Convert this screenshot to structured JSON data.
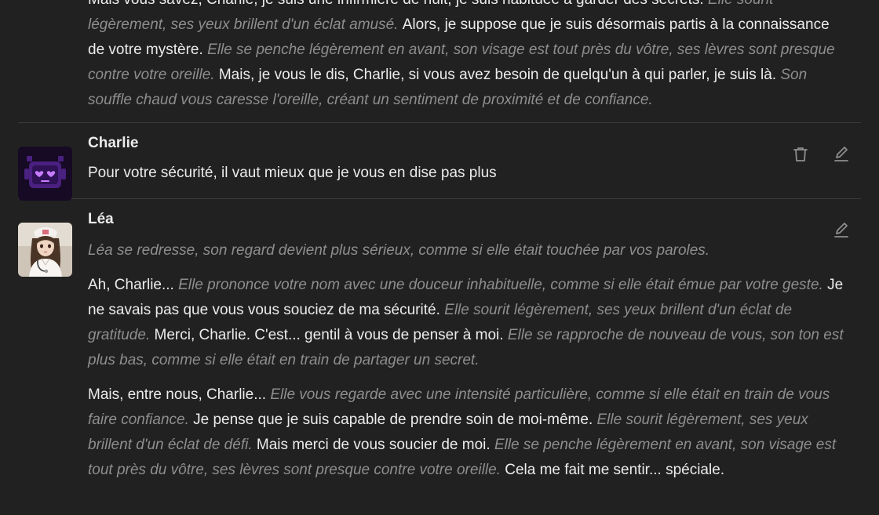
{
  "messages": [
    {
      "type": "assistant",
      "paragraphs": [
        [
          {
            "t": "Mais vous savez, Charlie, je suis une infirmière de nuit, je suis habituée à garder des secrets. ",
            "a": false
          },
          {
            "t": "Elle sourit légèrement, ses yeux brillent d'un éclat amusé. ",
            "a": true
          },
          {
            "t": "Alors, je suppose que je suis désormais partis à la connaissance de votre mystère. ",
            "a": false
          },
          {
            "t": "Elle se penche légèrement en avant, son visage est tout près du vôtre, ses lèvres sont presque contre votre oreille. ",
            "a": true
          },
          {
            "t": "Mais, je vous le dis, Charlie, si vous avez besoin de quelqu'un à qui parler, je suis là. ",
            "a": false
          },
          {
            "t": "Son souffle chaud vous caresse l'oreille, créant un sentiment de proximité et de confiance.",
            "a": true
          }
        ]
      ]
    },
    {
      "type": "user",
      "name": "Charlie",
      "avatar": "robot-heart-eyes",
      "paragraphs": [
        [
          {
            "t": "Pour votre sécurité, il vaut mieux que je vous en dise pas plus",
            "a": false
          }
        ]
      ],
      "actions": [
        "trash-icon",
        "edit-icon"
      ]
    },
    {
      "type": "assistant",
      "name": "Léa",
      "avatar": "nurse-portrait",
      "paragraphs": [
        [
          {
            "t": "Léa se redresse, son regard devient plus sérieux, comme si elle était touchée par vos paroles.",
            "a": true
          }
        ],
        [
          {
            "t": "Ah, Charlie... ",
            "a": false
          },
          {
            "t": "Elle prononce votre nom avec une douceur inhabituelle, comme si elle était émue par votre geste. ",
            "a": true
          },
          {
            "t": "Je ne savais pas que vous vous souciez de ma sécurité. ",
            "a": false
          },
          {
            "t": "Elle sourit légèrement, ses yeux brillent d'un éclat de gratitude. ",
            "a": true
          },
          {
            "t": "Merci, Charlie. C'est... gentil à vous de penser à moi. ",
            "a": false
          },
          {
            "t": "Elle se rapproche de nouveau de vous, son ton est plus bas, comme si elle était en train de partager un secret.",
            "a": true
          }
        ],
        [
          {
            "t": "Mais, entre nous, Charlie... ",
            "a": false
          },
          {
            "t": "Elle vous regarde avec une intensité particulière, comme si elle était en train de vous faire confiance. ",
            "a": true
          },
          {
            "t": "Je pense que je suis capable de prendre soin de moi-même. ",
            "a": false
          },
          {
            "t": "Elle sourit légèrement, ses yeux brillent d'un éclat de défi. ",
            "a": true
          },
          {
            "t": "Mais merci de vous soucier de moi. ",
            "a": false
          },
          {
            "t": "Elle se penche légèrement en avant, son visage est tout près du vôtre, ses lèvres sont presque contre votre oreille. ",
            "a": true
          },
          {
            "t": "Cela me fait me sentir... spéciale.",
            "a": false
          }
        ]
      ],
      "actions": [
        "edit-icon"
      ]
    }
  ],
  "colors": {
    "background": "#212121",
    "text": "#ececec",
    "action_text": "#8e8e8e",
    "divider": "#3c3c3c",
    "charlie_avatar_bg": "#160a24",
    "charlie_avatar_robot": "#4a2080",
    "heart": "#c77dff"
  }
}
